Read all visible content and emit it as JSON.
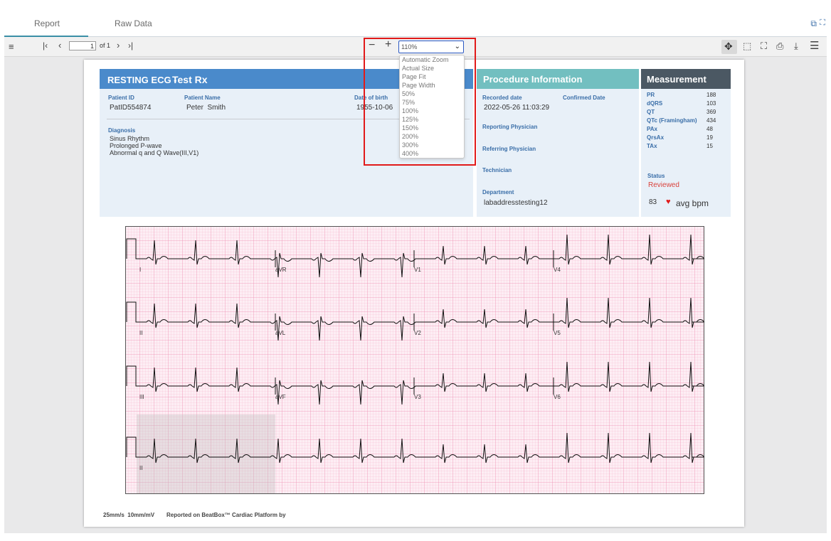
{
  "tabs": [
    {
      "label": "Report"
    },
    {
      "label": "Raw Data"
    }
  ],
  "toolbar": {
    "page_value": "1",
    "page_of": "of 1",
    "zoom_value": "110%",
    "zoom_options": [
      "Automatic Zoom",
      "Actual Size",
      "Page Fit",
      "Page Width",
      "50%",
      "75%",
      "100%",
      "125%",
      "150%",
      "200%",
      "300%",
      "400%"
    ]
  },
  "report": {
    "title": "RESTING ECG -",
    "subtitle": "Test Rx",
    "patient_id_label": "Patient ID",
    "patient_id": "PatID554874",
    "patient_name_label": "Patient Name",
    "patient_name": "Peter  Smith",
    "dob_label": "Date of birth",
    "dob": "1955-10-06",
    "diagnosis_label": "Diagnosis",
    "diagnosis": [
      "Sinus Rhythm",
      "Prolonged P-wave",
      "Abnormal q and Q Wave(III,V1)"
    ]
  },
  "procedure": {
    "title": "Procedure Information",
    "recorded_label": "Recorded date",
    "recorded": "2022-05-26 11:03:29",
    "confirmed_label": "Confirmed Date",
    "reporting_label": "Reporting Physician",
    "referring_label": "Referring Physician",
    "technician_label": "Technician",
    "department_label": "Department",
    "department": "labaddresstesting12"
  },
  "measurement": {
    "title": "Measurement",
    "items": [
      {
        "label": "PR",
        "value": "188"
      },
      {
        "label": "dQRS",
        "value": "103"
      },
      {
        "label": "QT",
        "value": "369"
      },
      {
        "label": "QTc (Framingham)",
        "value": "434"
      },
      {
        "label": "PAx",
        "value": "48"
      },
      {
        "label": "QrsAx",
        "value": "19"
      },
      {
        "label": "TAx",
        "value": "15"
      }
    ],
    "status_label": "Status",
    "status": "Reviewed",
    "bpm_value": "83",
    "bpm_unit": "avg bpm"
  },
  "ecg": {
    "leads": [
      "I",
      "aVR",
      "V1",
      "V4",
      "II",
      "aVL",
      "V2",
      "V5",
      "III",
      "aVF",
      "V3",
      "V6",
      "II"
    ]
  },
  "footer": {
    "settings": "25mm/s  10mm/mV",
    "platform": "Reported on BeatBox™ Cardiac Platform by"
  },
  "colors": {
    "accent_red": "#e11a1a",
    "header_blue": "#4a8acb",
    "header_teal": "#72bfc0",
    "header_dark": "#4b5863",
    "link_blue": "#3a6ea8"
  }
}
